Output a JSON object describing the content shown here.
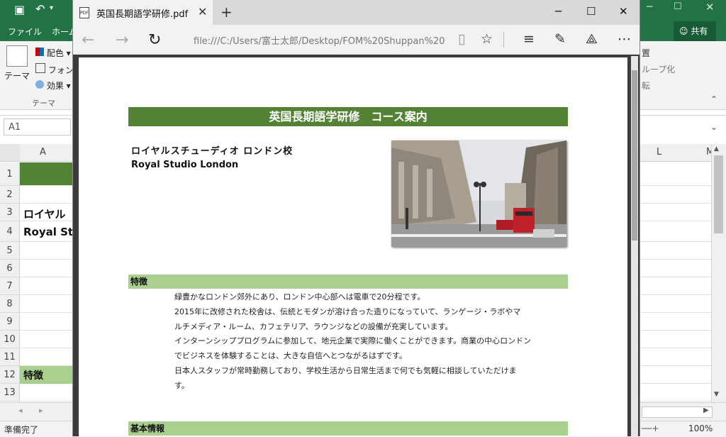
{
  "excel": {
    "ribbon_tabs": [
      "ファイル",
      "ホーム"
    ],
    "share_label": "共有",
    "theme_group": {
      "theme_label": "テーマ",
      "colors_label": "配色",
      "fonts_label": "フォント",
      "effects_label": "効果",
      "group_label": "テーマ"
    },
    "right_ribbon": {
      "item1": "置",
      "item2": "ループ化",
      "item3": "転"
    },
    "name_box": "A1",
    "columns": [
      "A",
      "L",
      "M"
    ],
    "rows": [
      "1",
      "2",
      "3",
      "4",
      "5",
      "6",
      "7",
      "8",
      "9",
      "10",
      "11",
      "12",
      "13"
    ],
    "cells": {
      "a3": "ロイヤル",
      "a4": "Royal St",
      "a12": "特徴"
    },
    "status_text": "準備完了",
    "zoom": "100%"
  },
  "browser": {
    "tab_title": "英国長期語学研修.pdf",
    "tab_icon_text": "PDF",
    "address": "file:///C:/Users/富士太郎/Desktop/FOM%20Shuppan%20"
  },
  "document": {
    "title": "英国長期語学研修　コース案内",
    "school_name_jp": "ロイヤルスチューディオ ロンドン校",
    "school_name_en": "Royal Studio London",
    "section_features": "特徴",
    "features_lines": [
      "緑豊かなロンドン郊外にあり、ロンドン中心部へは電車で20分程です。",
      "2015年に改修された校舎は、伝統とモダンが溶け合った造りになっていて、ランゲージ・ラボやマ",
      "ルチメディア・ルーム、カフェテリア、ラウンジなどの設備が充実しています。",
      "インターンシッププログラムに参加して、地元企業で実際に働くことができます。商業の中心ロンドン",
      "でビジネスを体験することは、大きな自信へとつながるはずです。",
      "日本人スタッフが常時勤務しており、学校生活から日常生活まで何でも気軽に相談していただけま",
      "す。"
    ],
    "section_basic": "基本情報"
  },
  "colors": {
    "excel_green": "#217346",
    "title_bar": "#548235",
    "section_bar": "#a9d08e"
  }
}
